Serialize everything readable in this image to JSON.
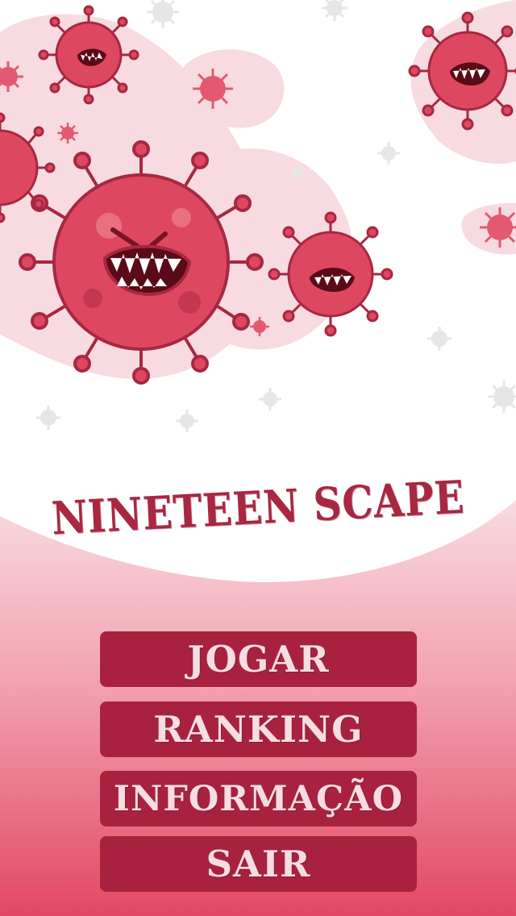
{
  "game": {
    "title": "NINETEEN SCAPE"
  },
  "menu": {
    "play_label": "JOGAR",
    "ranking_label": "RANKING",
    "info_label": "INFORMAÇÃO",
    "exit_label": "SAIR"
  },
  "colors": {
    "brand": "#a82741",
    "button_bg": "#a8223f",
    "button_text": "#f6dde2",
    "virus": "#dd4860",
    "virus_dark": "#a82741",
    "blob": "#f7dbe1",
    "gradient_top": "#f7d3da",
    "gradient_bottom": "#e34e67"
  },
  "icons": {
    "virus": "virus-monster-icon",
    "particle": "virus-particle-icon"
  }
}
